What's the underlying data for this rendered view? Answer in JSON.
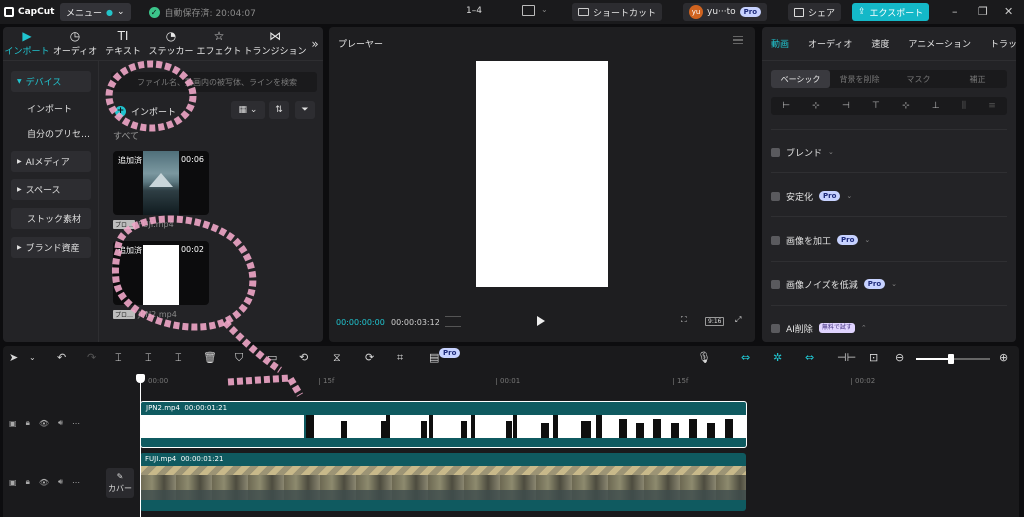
{
  "app": {
    "logo_text": "CapCut",
    "menu_label": "メニュー",
    "autosave_text": "自動保存済: 20:04:07",
    "project_title": "1–4",
    "shortcut_label": "ショートカット",
    "user_name": "yu···to",
    "avatar_initials": "yu",
    "pro_label": "Pro",
    "share_label": "シェア",
    "export_label": "エクスポート",
    "colors": {
      "accent": "#20c4cf",
      "export": "#14b8c8",
      "clip_teal": "#0f5a60"
    }
  },
  "left_tabs": [
    {
      "icon": "▶",
      "label": "インポート"
    },
    {
      "icon": "◷",
      "label": "オーディオ"
    },
    {
      "icon": "TI",
      "label": "テキスト"
    },
    {
      "icon": "◔",
      "label": "ステッカー"
    },
    {
      "icon": "☆",
      "label": "エフェクト"
    },
    {
      "icon": "⋈",
      "label": "トランジション"
    }
  ],
  "side_nav": {
    "device": "デバイス",
    "import": "インポート",
    "presets": "自分のプリセ…",
    "ai_media": "AIメディア",
    "space": "スペース",
    "stock": "ストック素材",
    "brand": "ブランド資産"
  },
  "media": {
    "search_placeholder": "ファイル名、動画内の被写体、ラインを検索",
    "import_label": "インポート",
    "all_label": "すべて",
    "items": [
      {
        "status": "追加済",
        "duration": "00:06",
        "badge": "プロ…",
        "name": "FUJI.mp4"
      },
      {
        "status": "追加済",
        "duration": "00:02",
        "badge": "プロ…",
        "name": "JPN2.mp4"
      }
    ]
  },
  "player": {
    "title": "プレーヤー",
    "current_time": "00:00:00:00",
    "total_time": "00:00:03:12",
    "ratio_label": "9:16"
  },
  "right_panel": {
    "tabs": [
      "動画",
      "オーディオ",
      "速度",
      "アニメーション",
      "トラッ"
    ],
    "segments": [
      "ベーシック",
      "背景を削除",
      "マスク",
      "補正"
    ],
    "props": {
      "blend": "ブレンド",
      "stabilize": "安定化",
      "enhance": "画像を加工",
      "denoise": "画像ノイズを低減",
      "ai_remove": "AI削除",
      "free_trial": "無料で試す"
    }
  },
  "timeline": {
    "ruler": [
      "00:00",
      "15f",
      "00:01",
      "15f",
      "00:02"
    ],
    "clips": [
      {
        "name": "JPN2.mp4",
        "duration": "00:00:01:21"
      },
      {
        "name": "FUJI.mp4",
        "duration": "00:00:01:21"
      }
    ],
    "cover_label": "カバー"
  }
}
